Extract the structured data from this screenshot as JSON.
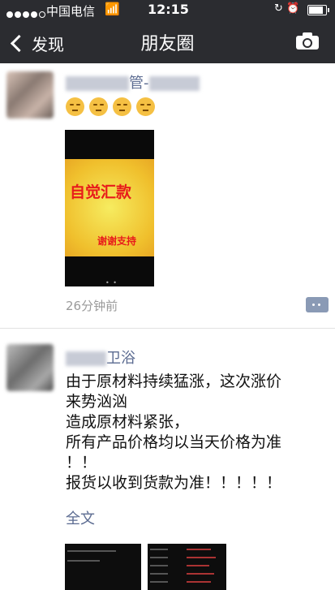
{
  "status_bar": {
    "carrier": "中国电信",
    "time": "12:15",
    "battery_level": 0.85,
    "icons": [
      "signal-dots-icon",
      "wifi-icon",
      "rotation-lock-icon",
      "alarm-icon",
      "battery-icon"
    ]
  },
  "nav": {
    "back_label": "发现",
    "title": "朋友圈",
    "camera_icon": "camera-icon"
  },
  "post1": {
    "username_visible": "管-",
    "emojis": [
      "pensive-emoji",
      "pensive-emoji",
      "pensive-emoji",
      "pensive-emoji"
    ],
    "image_text_main": "自觉汇款",
    "image_text_sub": "谢谢支持",
    "time": "26分钟前"
  },
  "post2": {
    "username_visible": "卫浴",
    "lines": [
      "由于原材料持续猛涨，这次涨价",
      "来势汹汹",
      "造成原材料紧张，",
      "所有产品价格均以当天价格为准",
      "！！",
      "报货以收到货款为准！！！！！"
    ],
    "full_text_link": "全文"
  },
  "colors": {
    "nav_bg": "#2b2c30",
    "username": "#5b6b91",
    "time_gray": "#9a9a9a",
    "image_red": "#e81b1b",
    "image_yellow": "#f0c02d"
  }
}
